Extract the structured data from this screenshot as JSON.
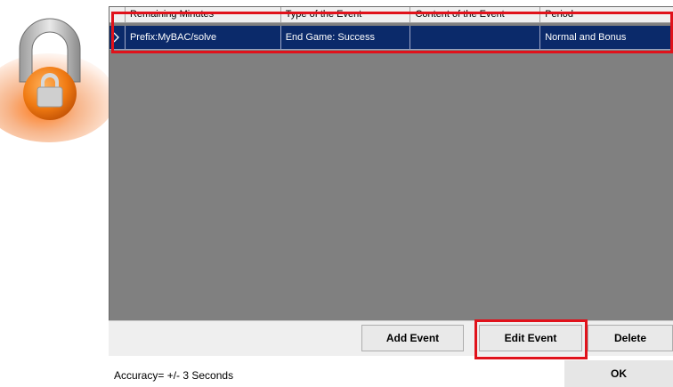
{
  "grid": {
    "columns": [
      "Remaining Minutes",
      "Type of the Event",
      "Content of the Event",
      "Period"
    ],
    "rows": [
      {
        "remaining": "Prefix:MyBAC/solve",
        "type": "End Game: Success",
        "content": "",
        "period": "Normal and Bonus"
      }
    ]
  },
  "toolbar": {
    "add_label": "Add Event",
    "edit_label": "Edit Event",
    "delete_label": "Delete"
  },
  "footer": {
    "accuracy_text": "Accuracy= +/- 3 Seconds",
    "ok_label": "OK"
  },
  "icons": {
    "logo": "padlock-icon",
    "row_selector": "chevron-right-icon"
  },
  "colors": {
    "selected_row": "#0b2a6a",
    "grid_background": "#808080",
    "highlight": "#e0121b"
  }
}
